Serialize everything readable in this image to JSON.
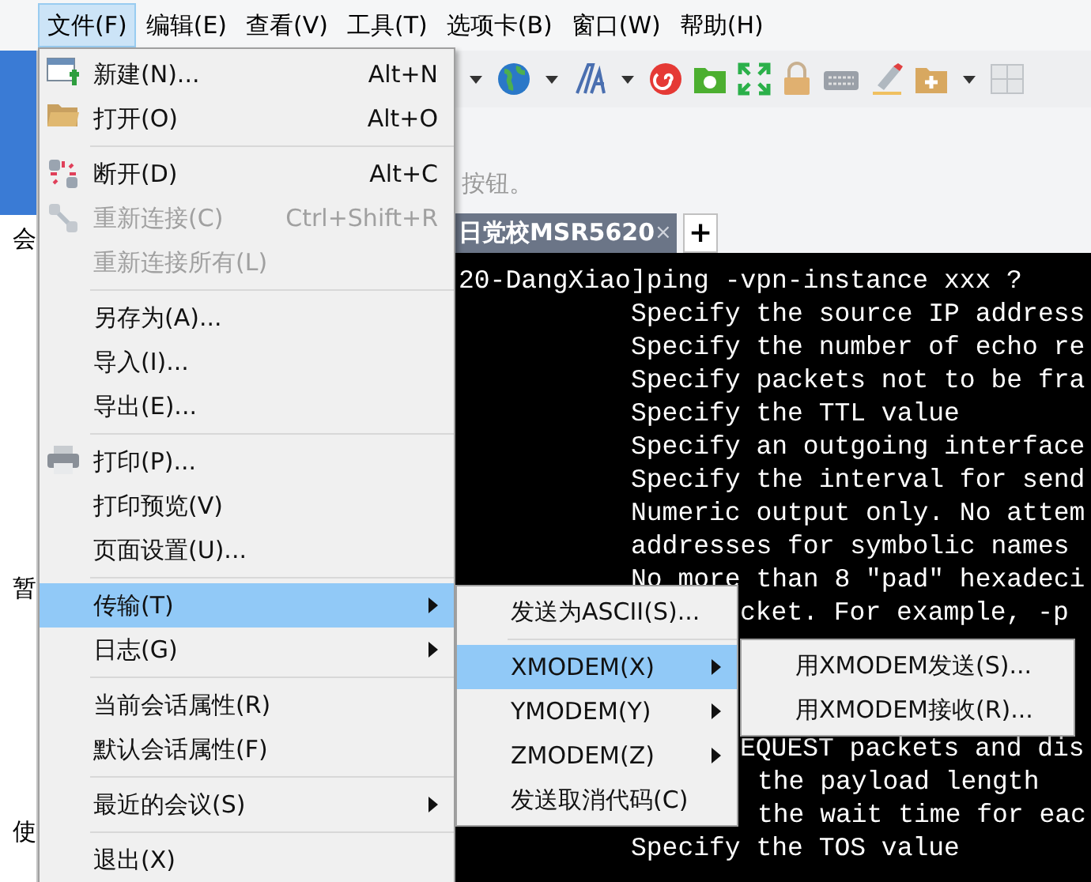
{
  "menu_bar": [
    {
      "label": "文件(F)",
      "selected": true
    },
    {
      "label": "编辑(E)",
      "selected": false
    },
    {
      "label": "查看(V)",
      "selected": false
    },
    {
      "label": "工具(T)",
      "selected": false
    },
    {
      "label": "选项卡(B)",
      "selected": false
    },
    {
      "label": "窗口(W)",
      "selected": false
    },
    {
      "label": "帮助(H)",
      "selected": false
    }
  ],
  "sidebar_fragments": [
    "会",
    "暂",
    "使"
  ],
  "hint": "按钮。",
  "session_tab": {
    "label": "日党校MSR5620",
    "selected": true,
    "close": "×"
  },
  "new_tab": "+",
  "terminal": {
    "top_lines": [
      {
        "kind": "prompt",
        "text": "20-DangXiao]ping -vpn-instance xxx ?"
      },
      {
        "kind": "help",
        "text": "Specify the source IP address"
      },
      {
        "kind": "help",
        "text": "Specify the number of echo re"
      },
      {
        "kind": "help",
        "text": "Specify packets not to be fra"
      },
      {
        "kind": "help",
        "text": "Specify the TTL value"
      },
      {
        "kind": "help",
        "text": "Specify an outgoing interface"
      },
      {
        "kind": "help",
        "text": "Specify the interval for send"
      },
      {
        "kind": "help",
        "text": "Numeric output only. No attem"
      },
      {
        "kind": "help",
        "text": "addresses for symbolic names"
      },
      {
        "kind": "help",
        "text": "No more than 8 \"pad\" hexadeci"
      },
      {
        "kind": "tail",
        "text": "cket. For example, -p"
      }
    ],
    "bottom_lines": [
      {
        "kind": "tail",
        "text": "EQUEST packets and dis"
      },
      {
        "kind": "tail2",
        "text": "the payload length"
      },
      {
        "kind": "tail2",
        "text": "the wait time for eac"
      },
      {
        "kind": "help",
        "text": "Specify the TOS value"
      }
    ]
  },
  "file_menu": {
    "items": [
      {
        "kind": "item",
        "label": "新建(N)...",
        "shortcut": "Alt+N",
        "disabled": false,
        "selected": false,
        "submenu": false
      },
      {
        "kind": "item",
        "label": "打开(O)",
        "shortcut": "Alt+O",
        "disabled": false,
        "selected": false,
        "submenu": false
      },
      {
        "kind": "separator"
      },
      {
        "kind": "item",
        "label": "断开(D)",
        "shortcut": "Alt+C",
        "disabled": false,
        "selected": false,
        "submenu": false
      },
      {
        "kind": "item",
        "label": "重新连接(C)",
        "shortcut": "Ctrl+Shift+R",
        "disabled": true,
        "selected": false,
        "submenu": false
      },
      {
        "kind": "item",
        "label": "重新连接所有(L)",
        "disabled": true,
        "selected": false,
        "submenu": false
      },
      {
        "kind": "separator"
      },
      {
        "kind": "item",
        "label": "另存为(A)...",
        "disabled": false,
        "selected": false,
        "submenu": false
      },
      {
        "kind": "item",
        "label": "导入(I)...",
        "disabled": false,
        "selected": false,
        "submenu": false
      },
      {
        "kind": "item",
        "label": "导出(E)...",
        "disabled": false,
        "selected": false,
        "submenu": false
      },
      {
        "kind": "separator"
      },
      {
        "kind": "item",
        "label": "打印(P)...",
        "disabled": false,
        "selected": false,
        "submenu": false
      },
      {
        "kind": "item",
        "label": "打印预览(V)",
        "disabled": false,
        "selected": false,
        "submenu": false
      },
      {
        "kind": "item",
        "label": "页面设置(U)...",
        "disabled": false,
        "selected": false,
        "submenu": false
      },
      {
        "kind": "separator"
      },
      {
        "kind": "item",
        "label": "传输(T)",
        "disabled": false,
        "selected": true,
        "submenu": true
      },
      {
        "kind": "item",
        "label": "日志(G)",
        "disabled": false,
        "selected": false,
        "submenu": true
      },
      {
        "kind": "separator"
      },
      {
        "kind": "item",
        "label": "当前会话属性(R)",
        "disabled": false,
        "selected": false,
        "submenu": false
      },
      {
        "kind": "item",
        "label": "默认会话属性(F)",
        "disabled": false,
        "selected": false,
        "submenu": false
      },
      {
        "kind": "separator"
      },
      {
        "kind": "item",
        "label": "最近的会议(S)",
        "disabled": false,
        "selected": false,
        "submenu": true
      },
      {
        "kind": "separator"
      },
      {
        "kind": "item",
        "label": "退出(X)",
        "disabled": false,
        "selected": false,
        "submenu": false
      }
    ]
  },
  "transfer_menu": {
    "items": [
      {
        "kind": "item",
        "label": "发送为ASCII(S)...",
        "disabled": false,
        "selected": false,
        "submenu": false
      },
      {
        "kind": "separator"
      },
      {
        "kind": "item",
        "label": "XMODEM(X)",
        "disabled": false,
        "selected": true,
        "submenu": true
      },
      {
        "kind": "item",
        "label": "YMODEM(Y)",
        "disabled": false,
        "selected": false,
        "submenu": true
      },
      {
        "kind": "item",
        "label": "ZMODEM(Z)",
        "disabled": false,
        "selected": false,
        "submenu": true
      },
      {
        "kind": "item",
        "label": "发送取消代码(C)",
        "disabled": false,
        "selected": false,
        "submenu": false
      }
    ]
  },
  "xmodem_menu": {
    "items": [
      {
        "kind": "item",
        "label": "用XMODEM发送(S)...",
        "disabled": false,
        "selected": false,
        "submenu": false
      },
      {
        "kind": "item",
        "label": "用XMODEM接收(R)...",
        "disabled": false,
        "selected": false,
        "submenu": false
      }
    ]
  }
}
